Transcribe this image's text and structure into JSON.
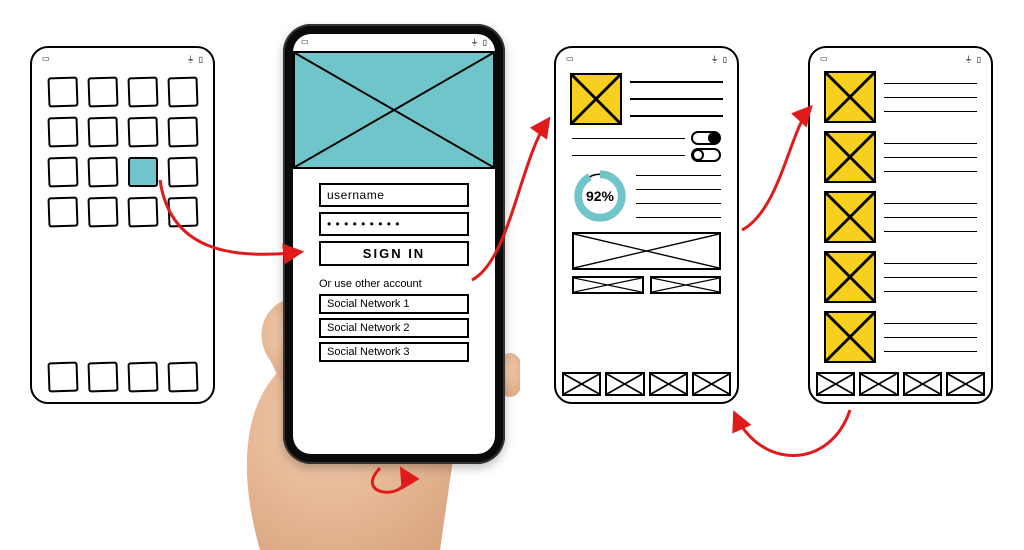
{
  "status": {
    "left_glyph": "▭",
    "wifi_glyph": "⏚",
    "battery_glyph": "▯"
  },
  "login": {
    "username_label": "username",
    "password_mask": "• • • • • • • • •",
    "signin_label": "SIGN IN",
    "or_text": "Or use other account",
    "socials": [
      "Social Network 1",
      "Social Network 2",
      "Social Network 3"
    ]
  },
  "profile": {
    "progress_pct": "92%",
    "toggle_a": true,
    "toggle_b": false
  },
  "colors": {
    "teal": "#6fc5c9",
    "yellow": "#f7cf1e",
    "arrow": "#e11b1b"
  },
  "flow_description": "Home grid → Login → Profile/Stats → Feed; Feed tab-bar loops back to Profile tab-bar; Login bottom loops to itself."
}
